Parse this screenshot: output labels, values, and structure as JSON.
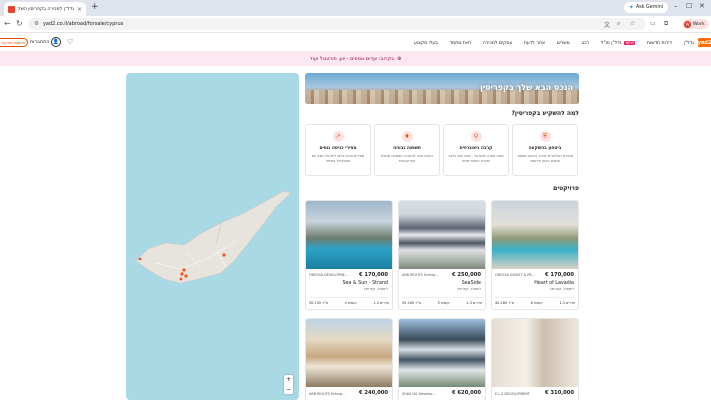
{
  "browser": {
    "tab_title": "נדל\"ן למכירה בקפריסין השקעו...",
    "tab_close": "×",
    "new_tab": "+",
    "gemini_label": "Ask Gemini",
    "url": "yad2.co.il/abroad/forsale/cyprus",
    "profile_label": "Work",
    "profile_initial": "W",
    "window_controls": [
      "–",
      "☐",
      "✕"
    ]
  },
  "header": {
    "logo": "yad2",
    "post_button": "+ פרסום מודעה",
    "login": "התחברות",
    "nav": [
      {
        "label": "נדל\"ן"
      },
      {
        "label": "דירות חדשות"
      },
      {
        "label": "נדל\"ן חו\"ל",
        "badge": "NEW"
      },
      {
        "label": "רכב"
      },
      {
        "label": "משרים"
      },
      {
        "label": "אחר לדעת"
      },
      {
        "label": "עסקים למכירה"
      },
      {
        "label": "חיות מחמד"
      },
      {
        "label": "בעלי מקצוע"
      }
    ]
  },
  "promo": {
    "text": "בקרוב: יעדים נוספים - יוון, פורטוגל ועוד"
  },
  "map": {
    "zoom_in": "+",
    "zoom_out": "−"
  },
  "hero": {
    "title": "הנכס הבא שלך בקפריסין"
  },
  "why": {
    "heading": "למה להשקיע בקפריסין?",
    "reasons": [
      {
        "icon": "shield-icon",
        "glyph": "⛨",
        "title": "ביטחון בהשקעה",
        "desc": "מסגרת רגולטורית יציבה, ביטחון משפטי ונכסים בשוק אירופאי"
      },
      {
        "icon": "location-pin-icon",
        "glyph": "⚲",
        "title": "קרבה גיאוגרפית",
        "desc": "טיסה קצרה מישראל - שעה וחצי בלבד ומבחר טיסות יומיות"
      },
      {
        "icon": "money-bag-icon",
        "glyph": "♦",
        "title": "תשואה גבוהה",
        "desc": "ביקוש גבוה להשכרה ותשואה שנתית אטרקטיבית"
      },
      {
        "icon": "trend-up-icon",
        "glyph": "↗",
        "title": "מחירי כניסה נוחים",
        "desc": "מחירים נוחים ביחס לישראל ושוק עם פוטנציאל צמיחה"
      }
    ]
  },
  "projects": {
    "heading": "פרויקטים",
    "row1": [
      {
        "price": "€ 170,000",
        "developer": "ODESSA INVEST & PR...",
        "name": "Heart of Lavadia",
        "location": "לימסול, קפריסין",
        "rooms": "1-3 חדרים",
        "floors": "6 קומות",
        "area": "40-180 מ\"ר"
      },
      {
        "price": "€ 250,000",
        "developer": "ARB RIGHTS Enterp...",
        "name": "SeaSide",
        "location": "לימסול, קפריסין",
        "rooms": "1-3 חדרים",
        "floors": "5 קומות",
        "area": "55-160 מ\"ר"
      },
      {
        "price": "€ 170,000",
        "developer": "ODESSA DEVELOPME...",
        "name": "Sea & Sun - Strand",
        "location": "לימסול, קפריסין",
        "rooms": "1-3 חדרים",
        "floors": "4 קומות",
        "area": "50-150 מ\"ר"
      }
    ],
    "row2": [
      {
        "price": "€ 310,000",
        "developer": "E.L.S DEVELOPMENT"
      },
      {
        "price": "€ 620,000",
        "developer": "SHAS NG Develop..."
      },
      {
        "price": "€ 240,000",
        "developer": "ARB RIGHTS Enterp..."
      }
    ]
  },
  "colors": {
    "accent": "#e65100",
    "promo_bg": "#fde7f1",
    "map_sea": "#aad9e6",
    "map_land": "#e6e4dd",
    "marker": "#f4511e"
  }
}
